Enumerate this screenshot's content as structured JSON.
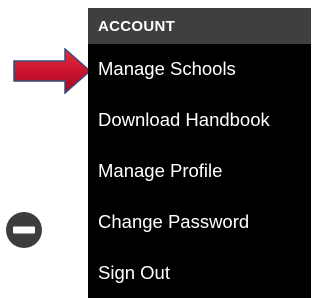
{
  "menu": {
    "header": "ACCOUNT",
    "items": [
      {
        "label": "Manage Schools"
      },
      {
        "label": "Download Handbook"
      },
      {
        "label": "Manage Profile"
      },
      {
        "label": "Change Password"
      },
      {
        "label": "Sign Out"
      }
    ]
  },
  "annotation": {
    "icon": "arrow-right-icon",
    "color": "#c8102e"
  },
  "side_icon": {
    "icon": "minus-circle-icon"
  }
}
